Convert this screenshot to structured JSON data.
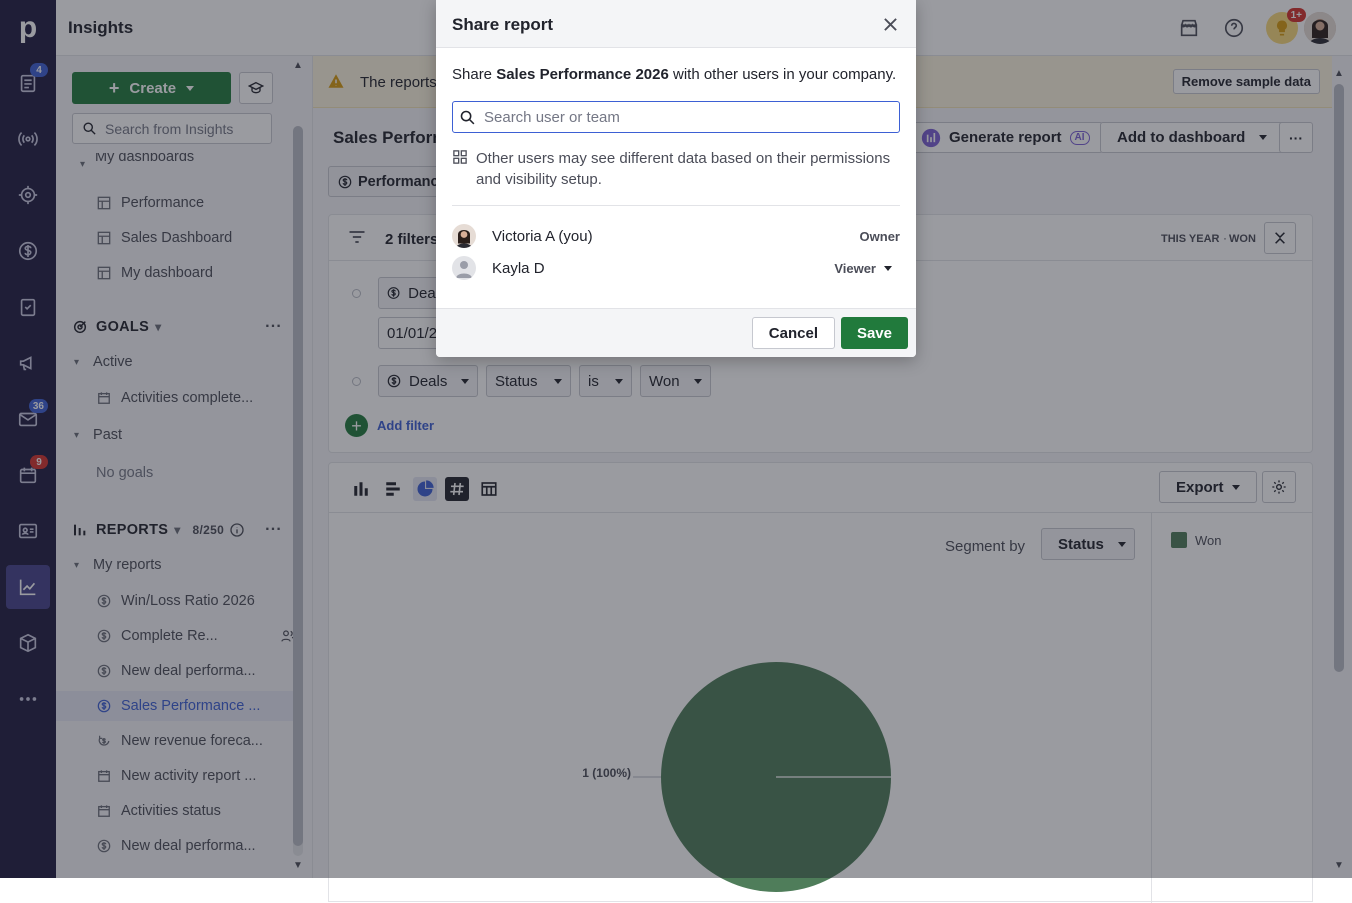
{
  "app": {
    "title": "Insights",
    "logo": "p"
  },
  "rail": {
    "badges": {
      "deals": "4",
      "mail": "36",
      "calendar": "9"
    }
  },
  "topbar": {
    "notification_badge": "1+"
  },
  "sidebar": {
    "create_label": "Create",
    "search_placeholder": "Search from Insights",
    "dashboards_header": "My dashboards",
    "dashboards": [
      "Performance",
      "Sales Dashboard",
      "My dashboard"
    ],
    "goals_header": "GOALS",
    "goals_active": "Active",
    "goals_active_items": [
      "Activities complete..."
    ],
    "goals_past": "Past",
    "goals_past_empty": "No goals",
    "reports_header": "REPORTS",
    "reports_count": "8/250",
    "my_reports": "My reports",
    "reports": [
      "Win/Loss Ratio 2026",
      "Complete Re...",
      "New deal performa...",
      "Sales Performance ...",
      "New revenue foreca...",
      "New activity report ...",
      "Activities status",
      "New deal performa..."
    ]
  },
  "main": {
    "banner_text": "The reports",
    "remove_sample": "Remove sample data",
    "report_title": "Sales Perform",
    "generate_report": "Generate report",
    "ai_badge": "AI",
    "add_to_dashboard": "Add to dashboard",
    "more": "···",
    "performance_chip": "Performanc",
    "filters_count": "2 filters",
    "filter_summary": [
      "THIS YEAR",
      "WON"
    ],
    "filter1_entity": "Deal",
    "filter1_value": "01/01/2",
    "filter2": {
      "entity": "Deals",
      "field": "Status",
      "operator": "is",
      "value": "Won"
    },
    "add_filter": "Add filter",
    "export": "Export",
    "segment_by_label": "Segment by",
    "segment_by_value": "Status",
    "legend": [
      {
        "name": "Won",
        "color": "#4f7d5a"
      }
    ]
  },
  "chart_data": {
    "type": "pie",
    "categories": [
      "Won"
    ],
    "values": [
      1
    ],
    "labels": [
      "1 (100%)"
    ],
    "colors": [
      "#4f7d5a"
    ],
    "legend_placement": "right"
  },
  "modal": {
    "title": "Share report",
    "desc_prefix": "Share",
    "report_name": "Sales Performance 2026",
    "desc_suffix": "with other users in your company.",
    "search_placeholder": "Search user or team",
    "note": "Other users may see different data based on their permissions and visibility setup.",
    "users": [
      {
        "name": "Victoria A (you)",
        "role": "Owner"
      },
      {
        "name": "Kayla D",
        "role": "Viewer"
      }
    ],
    "cancel": "Cancel",
    "save": "Save"
  }
}
